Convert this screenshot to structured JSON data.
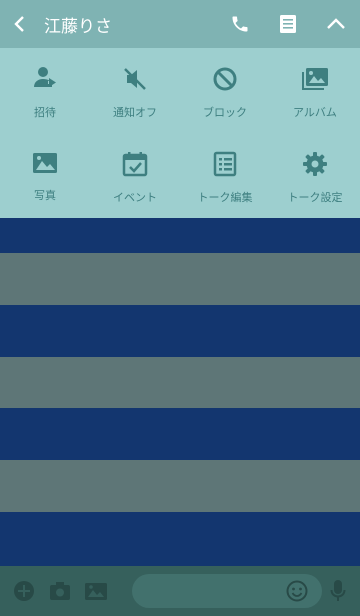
{
  "header": {
    "title": "江藤りさ"
  },
  "menu": {
    "items": [
      {
        "label": "招待",
        "icon": "add-user-icon"
      },
      {
        "label": "通知オフ",
        "icon": "mute-icon"
      },
      {
        "label": "ブロック",
        "icon": "block-icon"
      },
      {
        "label": "アルバム",
        "icon": "album-icon"
      },
      {
        "label": "写真",
        "icon": "photo-icon"
      },
      {
        "label": "イベント",
        "icon": "calendar-icon"
      },
      {
        "label": "トーク編集",
        "icon": "edit-list-icon"
      },
      {
        "label": "トーク設定",
        "icon": "settings-icon"
      }
    ]
  },
  "colors": {
    "header_bg": "#7fb3b3",
    "menu_bg": "#9dcfcf",
    "icon_color": "#3e7f80",
    "stripe_blue": "#13366f",
    "stripe_gray": "#5e7677",
    "footer_bg": "#36605c"
  }
}
